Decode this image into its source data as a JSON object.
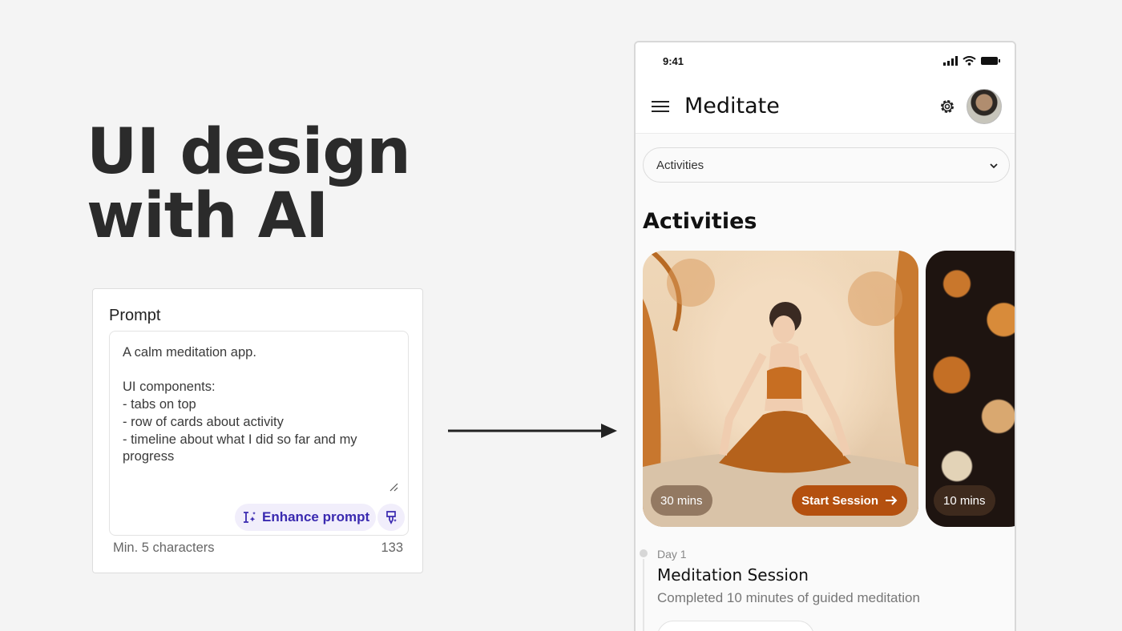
{
  "headline": {
    "line1": "UI design",
    "line2": "with AI"
  },
  "prompt": {
    "title": "Prompt",
    "text": "A calm meditation app.\n\nUI components:\n- tabs on top\n- row of cards about activity\n- timeline about what I did so far and my progress",
    "enhance_label": "Enhance prompt",
    "min_chars": "Min. 5 characters",
    "char_count": "133",
    "accent": "#3a2ab0"
  },
  "phone": {
    "status_time": "9:41",
    "app_title": "Meditate",
    "dropdown_value": "Activities",
    "section_title": "Activities",
    "cards": [
      {
        "duration": "30 mins",
        "action": "Start Session"
      },
      {
        "duration": "10 mins"
      }
    ],
    "timeline": {
      "day": "Day 1",
      "title": "Meditation Session",
      "description": "Completed 10 minutes of guided meditation"
    },
    "accent": "#b4500f"
  }
}
